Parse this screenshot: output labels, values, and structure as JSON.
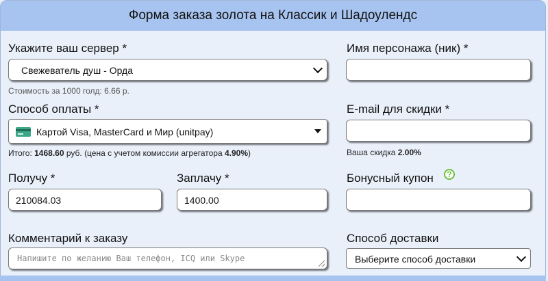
{
  "header": {
    "title": "Форма заказа золота на Классик и Шадоулендс"
  },
  "server": {
    "label": "Укажите ваш сервер *",
    "selected": "Свежеватель душ - Орда",
    "price_note": "Стоимость за 1000 голд: 6.66 р."
  },
  "character": {
    "label": "Имя персонажа (ник) *",
    "value": ""
  },
  "payment": {
    "label": "Способ оплаты *",
    "selected": "Картой Visa, MasterCard и Мир (unitpay)",
    "icon": "credit-card-icon",
    "total_prefix": "Итого: ",
    "total_value": "1468.60",
    "total_mid": " руб. (цена с учетом комиссии агрегатора ",
    "commission": "4.90%",
    "total_suffix": ")"
  },
  "email": {
    "label": "E-mail для скидки *",
    "value": "",
    "discount_prefix": "Ваша скидка ",
    "discount_value": "2.00%"
  },
  "receive": {
    "label": "Получу *",
    "value": "210084.03"
  },
  "pay": {
    "label": "Заплачу *",
    "value": "1400.00"
  },
  "coupon": {
    "label": "Бонусный купон",
    "value": "",
    "help_icon": "?"
  },
  "comment": {
    "label": "Комментарий к заказу",
    "placeholder": "Напишите по желанию Ваш телефон, ICQ или Skype"
  },
  "delivery": {
    "label": "Способ доставки",
    "selected": "Выберите способ доставки"
  },
  "colors": {
    "header_bg": "#a7c4f0",
    "page_bg": "#e9f0fa",
    "help_green": "#6bbf3a"
  }
}
